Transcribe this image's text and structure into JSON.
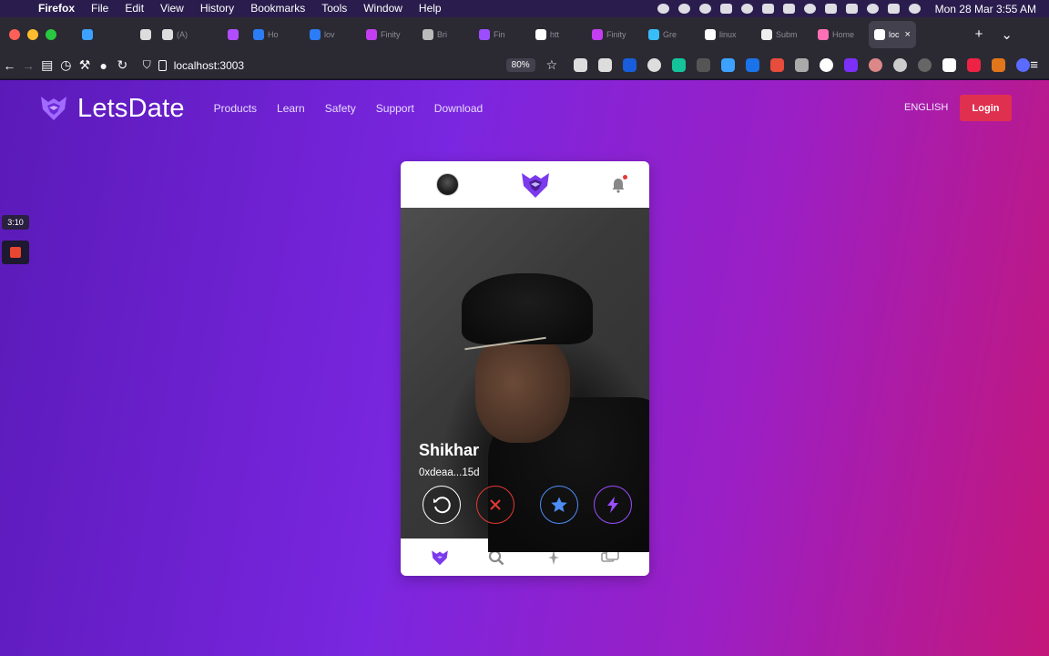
{
  "menubar": {
    "app_name": "Firefox",
    "menus": [
      "File",
      "Edit",
      "View",
      "History",
      "Bookmarks",
      "Tools",
      "Window",
      "Help"
    ],
    "clock": "Mon 28 Mar  3:55 AM"
  },
  "tabs": {
    "items": [
      {
        "label": "",
        "kind": "pinned",
        "icon": "diamond-icon",
        "color": "#3da2ff"
      },
      {
        "label": "",
        "kind": "pinned",
        "icon": "circle-icon",
        "color": "#2b2a33"
      },
      {
        "label": "",
        "kind": "pinned",
        "icon": "c-icon",
        "color": "#ddd"
      },
      {
        "label": "(A)",
        "kind": "pinned",
        "icon": "a-icon",
        "color": "#ddd"
      },
      {
        "label": "",
        "kind": "pinned",
        "icon": "circle-icon",
        "color": "#2b2a33"
      },
      {
        "label": "",
        "kind": "pinned",
        "icon": "play-icon",
        "color": "#b24dff"
      },
      {
        "label": "Ho",
        "kind": "titled",
        "icon": "c-icon",
        "color": "#2b7cf5"
      },
      {
        "label": "lov",
        "kind": "titled",
        "icon": "c-icon",
        "color": "#2b7cf5"
      },
      {
        "label": "Finity",
        "kind": "titled",
        "icon": "finity-icon",
        "color": "#c23ef0"
      },
      {
        "label": "Bri",
        "kind": "titled",
        "icon": "bri-icon",
        "color": "#bbb"
      },
      {
        "label": "Fin",
        "kind": "titled",
        "icon": "fox-icon",
        "color": "#9b4dff"
      },
      {
        "label": "htt",
        "kind": "titled",
        "icon": "triangle-icon",
        "color": "#fff"
      },
      {
        "label": "Finity",
        "kind": "titled",
        "icon": "finity-icon",
        "color": "#c23ef0"
      },
      {
        "label": "Gre",
        "kind": "titled",
        "icon": "wave-icon",
        "color": "#38bdf8"
      },
      {
        "label": "linux",
        "kind": "titled",
        "icon": "github-icon",
        "color": "#fff"
      },
      {
        "label": "Subm",
        "kind": "titled",
        "icon": "submit-icon",
        "color": "#eee"
      },
      {
        "label": "Home",
        "kind": "titled",
        "icon": "heart-icon",
        "color": "#ff6fb5"
      },
      {
        "label": "loc",
        "kind": "active",
        "icon": "triangle-icon",
        "color": "#fff"
      }
    ],
    "new_tab": "+",
    "overflow": "⌄"
  },
  "navbar": {
    "url": "localhost:3003",
    "zoom": "80%"
  },
  "extensions": [
    {
      "icon": "pocket-icon",
      "color": "#ddd"
    },
    {
      "icon": "download-icon",
      "color": "#ddd"
    },
    {
      "icon": "bitwarden-icon",
      "color": "#175ddc"
    },
    {
      "icon": "cloud-icon",
      "color": "#ddd"
    },
    {
      "icon": "grammarly-icon",
      "color": "#15c39a"
    },
    {
      "icon": "shield-icon",
      "color": "#555"
    },
    {
      "icon": "diamond-icon",
      "color": "#3da2ff"
    },
    {
      "icon": "s-icon",
      "color": "#1a73e8"
    },
    {
      "icon": "calendar-icon",
      "color": "#e74c3c"
    },
    {
      "icon": "pen-icon",
      "color": "#aaa"
    },
    {
      "icon": "power-icon",
      "color": "#fff"
    },
    {
      "icon": "hex-icon",
      "color": "#7b2ff7"
    },
    {
      "icon": "owl-icon",
      "color": "#d88"
    },
    {
      "icon": "gear-icon",
      "color": "#ccc"
    },
    {
      "icon": "k-icon",
      "color": "#666"
    },
    {
      "icon": "notion-icon",
      "color": "#fff"
    },
    {
      "icon": "grid-icon",
      "color": "#e24"
    },
    {
      "icon": "fox-icon",
      "color": "#e2761b"
    },
    {
      "icon": "face-icon",
      "color": "#5b6bff"
    }
  ],
  "site": {
    "brand": "LetsDate",
    "nav": [
      "Products",
      "Learn",
      "Safety",
      "Support",
      "Download"
    ],
    "language": "ENGLISH",
    "login": "Login"
  },
  "recorder": {
    "time": "3:10"
  },
  "profile": {
    "name": "Shikhar",
    "address": "0xdeaa...15d"
  },
  "colors": {
    "brand_purple": "#7a26e0",
    "login_red": "#e0304f",
    "nope_red": "#e53935",
    "star_blue": "#4d8df5",
    "boost_purple": "#9b4dff"
  }
}
